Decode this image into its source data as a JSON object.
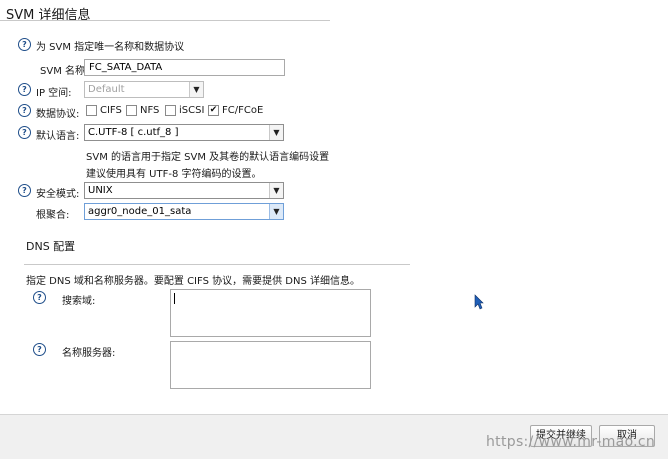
{
  "page": {
    "title": "SVM 详细信息",
    "intro": "为 SVM 指定唯一名称和数据协议"
  },
  "form": {
    "svm_name_label": "SVM 名称:",
    "svm_name_value": "FC_SATA_DATA",
    "ipspace_label": "IP 空间:",
    "ipspace_value": "Default",
    "protocols_label": "数据协议:",
    "protocols": [
      {
        "label": "CIFS",
        "checked": false
      },
      {
        "label": "NFS",
        "checked": false
      },
      {
        "label": "iSCSI",
        "checked": false
      },
      {
        "label": "FC/FCoE",
        "checked": true
      }
    ],
    "language_label": "默认语言:",
    "language_value": "C.UTF-8 [ c.utf_8 ]",
    "language_hint_1": "SVM 的语言用于指定 SVM 及其卷的默认语言编码设置",
    "language_hint_2": "建议使用具有 UTF-8 字符编码的设置。",
    "security_label": "安全模式:",
    "security_value": "UNIX",
    "root_aggr_label": "根聚合:",
    "root_aggr_value": "aggr0_node_01_sata"
  },
  "dns": {
    "title": "DNS 配置",
    "desc": "指定 DNS 域和名称服务器。要配置 CIFS 协议，需要提供 DNS 详细信息。",
    "search_domain_label": "搜索域:",
    "name_servers_label": "名称服务器:"
  },
  "footer": {
    "submit_label": "提交并继续",
    "cancel_label": "取消"
  },
  "watermark": "https://www.mr-mao.cn",
  "icons": {
    "help": "help-icon",
    "dropdown": "chevron-down-icon",
    "check": "checkmark-icon",
    "cursor": "mouse-cursor-icon"
  },
  "colors": {
    "help_icon": "#1f4e8a",
    "dropdown_active_border": "#6f9fd8"
  }
}
